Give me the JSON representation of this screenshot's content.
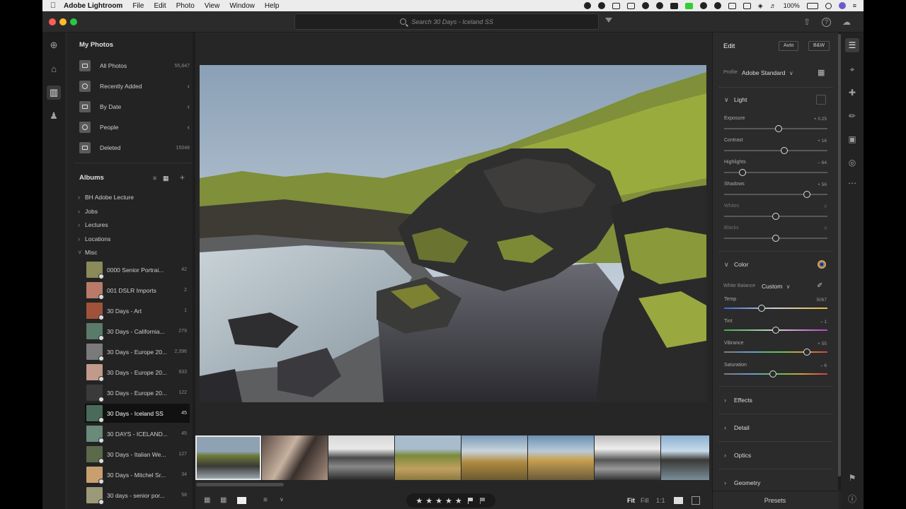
{
  "menubar": {
    "app_name": "Adobe Lightroom",
    "menus": [
      "File",
      "Edit",
      "Photo",
      "View",
      "Window",
      "Help"
    ],
    "battery": "100%"
  },
  "titlebar": {
    "search_placeholder": "Search 30 Days - Iceland SS"
  },
  "sidebar": {
    "my_photos_title": "My Photos",
    "my_photos": [
      {
        "label": "All Photos",
        "count": "55,847",
        "icon": "photo-icon"
      },
      {
        "label": "Recently Added",
        "count": "",
        "icon": "clock-icon"
      },
      {
        "label": "By Date",
        "count": "",
        "icon": "calendar-icon"
      },
      {
        "label": "People",
        "count": "",
        "icon": "person-icon"
      },
      {
        "label": "Deleted",
        "count": "15048",
        "icon": "trash-icon"
      }
    ],
    "albums_title": "Albums",
    "folders": [
      "BH Adobe Lecture",
      "Jobs",
      "Lectures",
      "Locations",
      "Misc"
    ],
    "albums": [
      {
        "name": "0000 Senior Portrai...",
        "count": "42",
        "color": "#8a8a5a"
      },
      {
        "name": "001   DSLR Imports",
        "count": "2",
        "color": "#b97a6a"
      },
      {
        "name": "30 Days - Art",
        "count": "1",
        "color": "#a0533a"
      },
      {
        "name": "30 Days - California...",
        "count": "279",
        "color": "#5a7a6a"
      },
      {
        "name": "30 Days - Europe 20...",
        "count": "2,396",
        "color": "#7a7a7a"
      },
      {
        "name": "30 Days - Europe 20...",
        "count": "933",
        "color": "#c09a8a"
      },
      {
        "name": "30 Days - Europe 20...",
        "count": "122",
        "color": "#3a3a3a"
      },
      {
        "name": "30 Days - Iceland SS",
        "count": "45",
        "color": "#4a6a5a"
      },
      {
        "name": "30 DAYS - ICELAND...",
        "count": "45",
        "color": "#6a8a7a"
      },
      {
        "name": "30 Days - Italian We...",
        "count": "127",
        "color": "#5a6a4a"
      },
      {
        "name": "30 Days - Mitchel Sr...",
        "count": "34",
        "color": "#c8a070"
      },
      {
        "name": "30 days - senior por...",
        "count": "58",
        "color": "#9a9a7a"
      }
    ]
  },
  "bottombar": {
    "zoom_fit": "Fit",
    "zoom_fill": "Fill",
    "zoom_1to1": "1:1"
  },
  "edit": {
    "title": "Edit",
    "auto_label": "Auto",
    "bw_label": "B&W",
    "profile_label": "Profile",
    "profile_value": "Adobe Standard",
    "light_title": "Light",
    "light_sliders": [
      {
        "label": "Exposure",
        "value": "+ 0.25",
        "pos": 0.53,
        "dim": false
      },
      {
        "label": "Contrast",
        "value": "+ 16",
        "pos": 0.58,
        "dim": false
      },
      {
        "label": "Highlights",
        "value": "– 64",
        "pos": 0.18,
        "dim": false
      },
      {
        "label": "Shadows",
        "value": "+ 56",
        "pos": 0.8,
        "dim": false
      },
      {
        "label": "Whites",
        "value": "0",
        "pos": 0.5,
        "dim": true
      },
      {
        "label": "Blacks",
        "value": "0",
        "pos": 0.5,
        "dim": true
      }
    ],
    "color_title": "Color",
    "wb_label": "White Balance",
    "wb_value": "Custom",
    "color_sliders": [
      {
        "label": "Temp",
        "value": "5067",
        "pos": 0.36,
        "kind": "temp"
      },
      {
        "label": "Tint",
        "value": "– 1",
        "pos": 0.5,
        "kind": "tint"
      },
      {
        "label": "Vibrance",
        "value": "+ 55",
        "pos": 0.8,
        "kind": "sat"
      },
      {
        "label": "Saturation",
        "value": "– 6",
        "pos": 0.47,
        "kind": "sat"
      }
    ],
    "collapsed_sections": [
      "Effects",
      "Detail",
      "Optics",
      "Geometry"
    ],
    "presets_label": "Presets"
  }
}
